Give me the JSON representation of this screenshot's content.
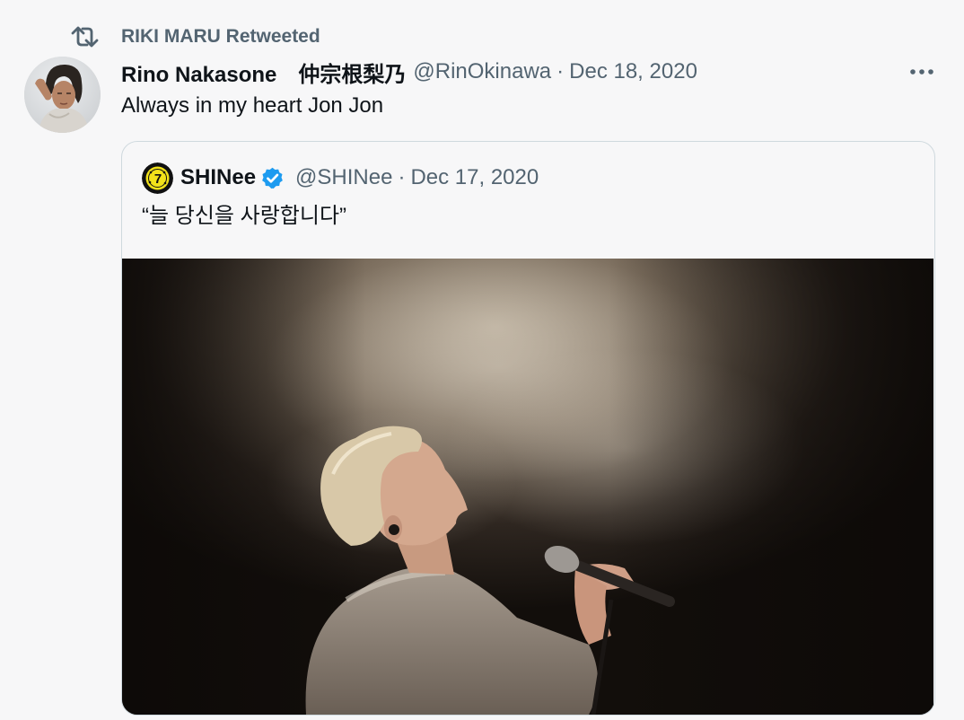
{
  "retweet": {
    "label": "RIKI MARU Retweeted",
    "icon": "retweet-icon"
  },
  "tweet": {
    "display_name": "Rino Nakasone　仲宗根梨乃",
    "handle": "@RinOkinawa",
    "separator": "·",
    "date": "Dec 18, 2020",
    "text": "Always in my heart Jon Jon",
    "more_icon": "more-dots-icon"
  },
  "quote": {
    "display_name": "SHINee",
    "verified_icon": "verified-badge-icon",
    "handle": "@SHINee",
    "separator": "·",
    "date": "Dec 17, 2020",
    "text": "“늘 당신을 사랑합니다”",
    "photo_alt": "photo"
  },
  "colors": {
    "background": "#f7f7f8",
    "text": "#0f1419",
    "muted": "#536471",
    "border": "#cfd9de",
    "verified": "#1d9bf0",
    "shinee_badge": "#f2e21a"
  }
}
